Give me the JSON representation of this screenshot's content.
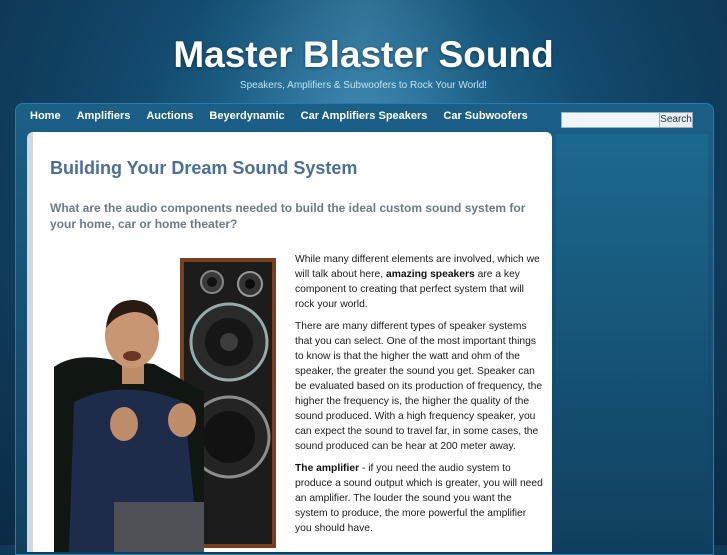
{
  "header": {
    "site_title": "Master Blaster Sound",
    "tagline": "Speakers, Amplifiers & Subwoofers to Rock Your World!"
  },
  "nav": {
    "items": [
      {
        "label": "Home"
      },
      {
        "label": "Amplifiers"
      },
      {
        "label": "Auctions"
      },
      {
        "label": "Beyerdynamic"
      },
      {
        "label": "Car Amplifiers Speakers"
      },
      {
        "label": "Car Subwoofers"
      }
    ]
  },
  "search": {
    "placeholder": "",
    "value": "",
    "button_label": "Search"
  },
  "article": {
    "title": "Building Your Dream Sound System",
    "subtitle": "What are the audio components needed to build the ideal custom sound system for your home, car or home theater?",
    "p1_before": "While many different elements are involved, which we will talk about here, ",
    "p1_bold": "amazing speakers",
    "p1_after": " are a key component to creating that perfect system that will rock your world.",
    "p2": "There are many different types of speaker systems that you can select. One of the most important things to know is that the higher the watt and ohm of the speaker, the greater the sound you get. Speaker can be evaluated based on its production of frequency, the higher the frequency is, the higher the quality of the sound produced. With a high frequency speaker, you can expect the sound to travel far, in some cases, the sound produced can be hear at 200 meter away.",
    "p3_bold": "The amplifier",
    "p3_after": " - if you need the audio system to produce a sound output which is greater, you will need an amplifier. The louder the sound you want the system to produce, the more powerful the amplifier you should have."
  },
  "colors": {
    "title_blue": "#4a6f98",
    "subtitle_gray": "#6b7b86",
    "background_teal": "#134a6e"
  }
}
